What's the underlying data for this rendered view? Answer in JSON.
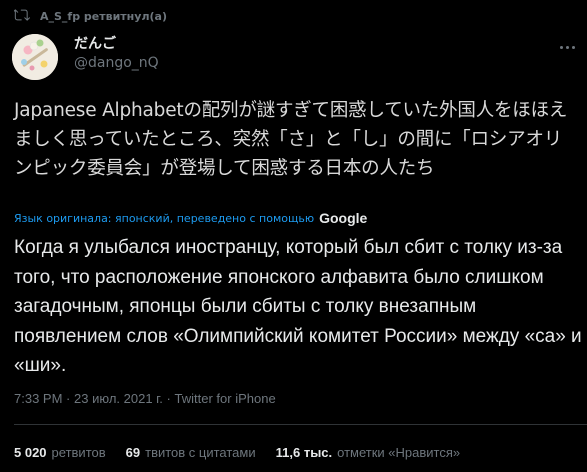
{
  "retweet": {
    "icon": "retweet-icon",
    "text": "A_S_fp ретвитнул(а)"
  },
  "author": {
    "display_name": "だんご",
    "handle": "@dango_nQ",
    "avatar": "avatar-image"
  },
  "tweet": {
    "original_text": "Japanese Alphabetの配列が謎すぎて困惑していた外国人をほほえましく思っていたところ、突然「さ」と「し」の間に「ロシアオリンピック委員会」が登場して困惑する日本の人たち",
    "translation_note": "Язык оригинала: японский, переведено с помощью",
    "translation_provider": "Google",
    "translated_text": "Когда я улыбался иностранцу, который был сбит с толку из-за того, что расположение японского алфавита было слишком загадочным, японцы были сбиты с толку внезапным появлением слов «Олимпийский комитет России» между «са» и «ши».",
    "time": "7:33 PM",
    "separator": "·",
    "date": "23 июл. 2021 г.",
    "source": "Twitter for iPhone"
  },
  "stats": [
    {
      "value": "5 020",
      "label": "ретвитов"
    },
    {
      "value": "69",
      "label": "твитов с цитатами"
    },
    {
      "value": "11,6 тыс.",
      "label": "отметки «Нравится»"
    }
  ],
  "colors": {
    "background": "#000000",
    "text": "#e7e9ea",
    "secondary": "#6e767d",
    "link": "#1d9bf0",
    "divider": "#2f3336"
  }
}
